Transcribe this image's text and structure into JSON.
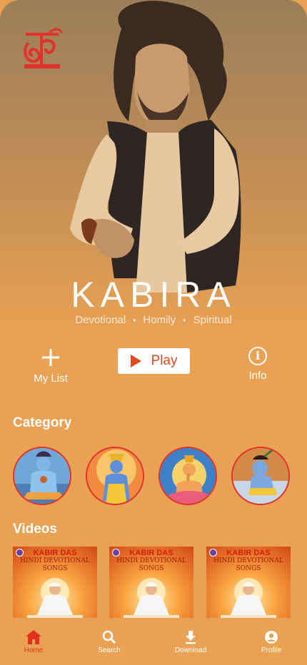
{
  "app": {
    "logo_glyph": "श्री",
    "logo_color": "#e0322b",
    "accent": "#e24a1f",
    "background": "#e9a154"
  },
  "hero": {
    "title": "KABIRA",
    "genres": [
      "Devotional",
      "Homily",
      "Spiritual"
    ],
    "separator": "•"
  },
  "actions": {
    "mylist_icon": "plus-icon",
    "mylist_label": "My List",
    "play_label": "Play",
    "info_icon": "info-icon",
    "info_glyph": "i",
    "info_label": "Info"
  },
  "category": {
    "title": "Category",
    "items": [
      {
        "icon": "shiva-image"
      },
      {
        "icon": "rama-image"
      },
      {
        "icon": "ganesha-image"
      },
      {
        "icon": "krishna-image"
      }
    ]
  },
  "videos": {
    "title": "Videos",
    "items": [
      {
        "line1": "KABIR DAS",
        "line2": "HINDI DEVOTIONAL",
        "line3": "SONGS"
      },
      {
        "line1": "KABIR DAS",
        "line2": "HINDI DEVOTIONAL",
        "line3": "SONGS"
      },
      {
        "line1": "KABIR DAS",
        "line2": "HINDI DEVOTIONAL",
        "line3": "SONGS"
      }
    ]
  },
  "nav": {
    "items": [
      {
        "label": "Home",
        "icon": "home-icon",
        "active": true
      },
      {
        "label": "Search",
        "icon": "search-icon",
        "active": false
      },
      {
        "label": "Download",
        "icon": "download-icon",
        "active": false
      },
      {
        "label": "Profile",
        "icon": "profile-icon",
        "active": false
      }
    ]
  }
}
